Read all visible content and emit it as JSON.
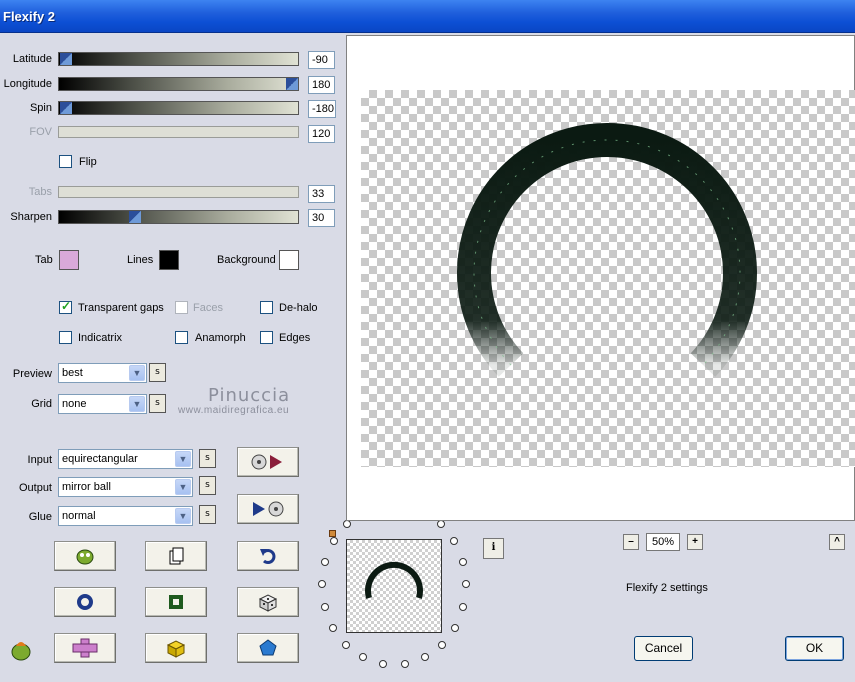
{
  "window": {
    "title": "Flexify 2"
  },
  "sliders": [
    {
      "label": "Latitude",
      "value": "-90",
      "fraction": 0.0,
      "enabled": true
    },
    {
      "label": "Longitude",
      "value": "180",
      "fraction": 1.0,
      "enabled": true
    },
    {
      "label": "Spin",
      "value": "-180",
      "fraction": 0.0,
      "enabled": true
    },
    {
      "label": "FOV",
      "value": "120",
      "fraction": null,
      "enabled": false
    },
    {
      "label": "Tabs",
      "value": "33",
      "fraction": null,
      "enabled": false
    },
    {
      "label": "Sharpen",
      "value": "30",
      "fraction": 0.3,
      "enabled": true
    }
  ],
  "flip": {
    "label": "Flip",
    "checked": false
  },
  "colors": {
    "tab_label": "Tab",
    "tab_color": "#d9a9d9",
    "lines_label": "Lines",
    "lines_color": "#000000",
    "background_label": "Background",
    "background_color": "#ffffff"
  },
  "options": {
    "transparent_gaps": {
      "label": "Transparent gaps",
      "checked": true
    },
    "faces": {
      "label": "Faces",
      "checked": false,
      "enabled": false
    },
    "de_halo": {
      "label": "De-halo",
      "checked": false
    },
    "indicatrix": {
      "label": "Indicatrix",
      "checked": false
    },
    "anamorph": {
      "label": "Anamorph",
      "checked": false
    },
    "edges": {
      "label": "Edges",
      "checked": false
    }
  },
  "preview": {
    "label": "Preview",
    "value": "best",
    "s_label": "s"
  },
  "grid": {
    "label": "Grid",
    "value": "none",
    "s_label": "s"
  },
  "watermark": {
    "name": "Pinuccia",
    "url": "www.maidiregrafica.eu"
  },
  "projection": {
    "input": {
      "label": "Input",
      "value": "equirectangular",
      "s_label": "s"
    },
    "output": {
      "label": "Output",
      "value": "mirror ball",
      "s_label": "s"
    },
    "glue": {
      "label": "Glue",
      "value": "normal",
      "s_label": "s"
    }
  },
  "zoom": {
    "minus": "–",
    "value": "50%",
    "plus": "+"
  },
  "info": {
    "label": "i"
  },
  "collapse": {
    "label": "^"
  },
  "settings_label": "Flexify 2 settings",
  "buttons": {
    "cancel": "Cancel",
    "ok": "OK"
  },
  "accent_colors": {
    "ring_dark": "#0b1a12",
    "ring_highlight": "#7fbf8e",
    "title_blue": "#0c4fd4"
  }
}
